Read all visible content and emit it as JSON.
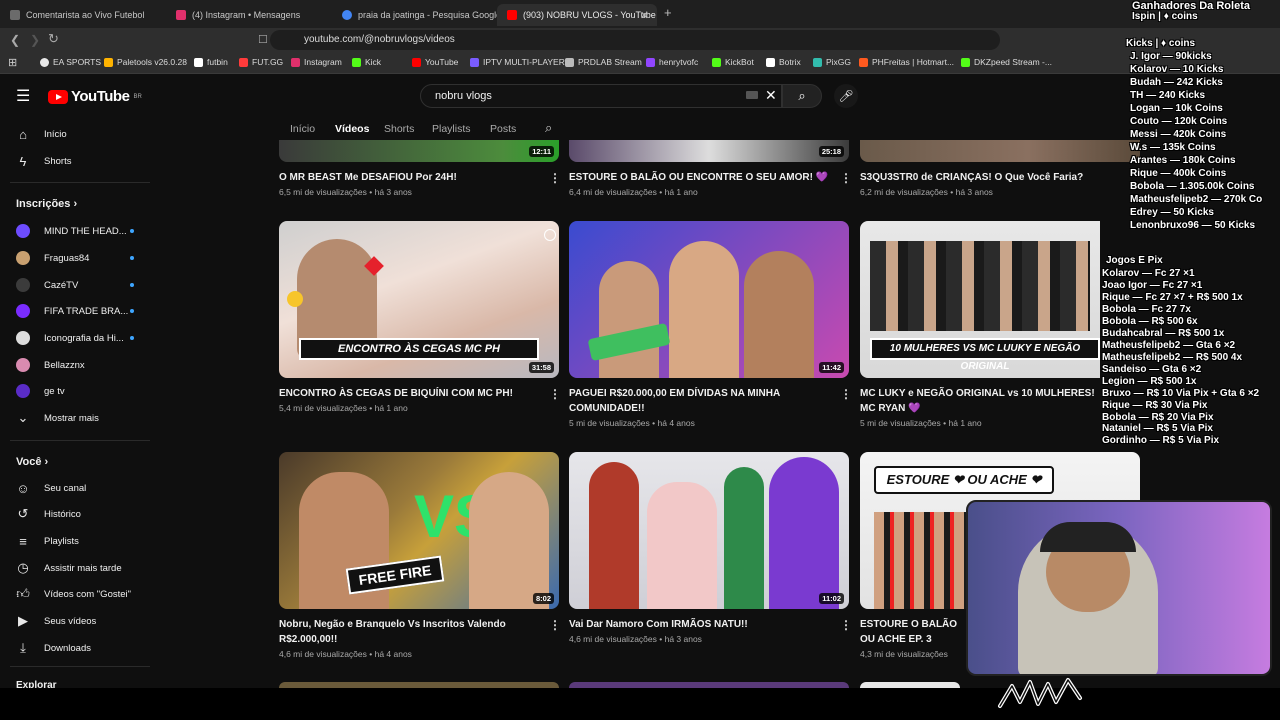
{
  "browser": {
    "tabs": [
      {
        "label": "Comentarista ao Vivo Futebol",
        "color": "#6b6b6b"
      },
      {
        "label": "(4) Instagram • Mensagens",
        "color": "#e1306c"
      },
      {
        "label": "praia da joatinga - Pesquisa Google",
        "color": "#4285f4"
      },
      {
        "label": "(903) NOBRU VLOGS - YouTube",
        "color": "#ff0000"
      }
    ],
    "new_tab": "+",
    "url": "youtube.com/@nobruvlogs/videos",
    "bookmarks": [
      {
        "label": "EA SPORTS",
        "color": "#e8e8e8"
      },
      {
        "label": "Paletools v26.0.28",
        "color": "#ffb300"
      },
      {
        "label": "futbin",
        "color": "#ffffff"
      },
      {
        "label": "FUT.GG",
        "color": "#ff3b3b"
      },
      {
        "label": "Instagram",
        "color": "#e1306c"
      },
      {
        "label": "Kick",
        "color": "#53fc18"
      },
      {
        "label": "YouTube",
        "color": "#ff0000"
      },
      {
        "label": "IPTV MULTI-PLAYER",
        "color": "#7a5cff"
      },
      {
        "label": "PRDLAB Stream",
        "color": "#bbbbbb"
      },
      {
        "label": "henrytvofc",
        "color": "#9146ff"
      },
      {
        "label": "KickBot",
        "color": "#53fc18"
      },
      {
        "label": "Botrix",
        "color": "#ffffff"
      },
      {
        "label": "PixGG",
        "color": "#32bcad"
      },
      {
        "label": "PHFreitas | Hotmart...",
        "color": "#ff5a1f"
      },
      {
        "label": "DKZpeed Stream -...",
        "color": "#53fc18"
      }
    ]
  },
  "youtube": {
    "region": "BR",
    "search_value": "nobru vlogs",
    "channel_tabs": [
      "Início",
      "Vídeos",
      "Shorts",
      "Playlists",
      "Posts"
    ],
    "active_tab": "Vídeos",
    "sidebar": {
      "top": [
        {
          "label": "Início",
          "icon": "home-icon"
        },
        {
          "label": "Shorts",
          "icon": "shorts-icon"
        }
      ],
      "subscriptions_header": "Inscrições",
      "subscriptions": [
        {
          "label": "MIND THE HEAD...",
          "color": "#6d4cff"
        },
        {
          "label": "Fraguas84",
          "color": "#c8a070"
        },
        {
          "label": "CazéTV",
          "color": "#3b3b3b"
        },
        {
          "label": "FIFA TRADE BRA...",
          "color": "#7a2cff"
        },
        {
          "label": "Iconografia da Hi...",
          "color": "#dcdcdc"
        },
        {
          "label": "Bellazznx",
          "color": "#d98bb0"
        },
        {
          "label": "ge tv",
          "color": "#5a2cc7"
        }
      ],
      "show_more": "Mostrar mais",
      "you_header": "Você",
      "you": [
        {
          "label": "Seu canal",
          "icon": "channel-icon"
        },
        {
          "label": "Histórico",
          "icon": "history-icon"
        },
        {
          "label": "Playlists",
          "icon": "playlists-icon"
        },
        {
          "label": "Assistir mais tarde",
          "icon": "watch-later-icon"
        },
        {
          "label": "Vídeos com \"Gostei\"",
          "icon": "like-icon"
        },
        {
          "label": "Seus vídeos",
          "icon": "your-videos-icon"
        },
        {
          "label": "Downloads",
          "icon": "download-icon"
        }
      ],
      "explore_header": "Explorar"
    },
    "videos": [
      {
        "title": "O MR BEAST Me DESAFIOU Por 24H!",
        "views": "6,5 mi de visualizações",
        "age": "há 3 anos",
        "duration": "12:11"
      },
      {
        "title": "ESTOURE O BALÃO OU ENCONTRE O SEU AMOR! 💜",
        "views": "6,4 mi de visualizações",
        "age": "há 1 ano",
        "duration": "25:18"
      },
      {
        "title": "S3QU3STR0 de CRIANÇAS! O Que Você Faria?",
        "views": "6,2 mi de visualizações",
        "age": "há 3 anos",
        "duration": ""
      },
      {
        "title": "ENCONTRO ÀS CEGAS DE BIQUÍNI COM MC PH!",
        "views": "5,4 mi de visualizações",
        "age": "há 1 ano",
        "duration": "31:58",
        "banner": "ENCONTRO ÀS CEGAS MC PH"
      },
      {
        "title": "PAGUEI R$20.000,00 EM DÍVIDAS NA MINHA COMUNIDADE!!",
        "views": "5 mi de visualizações",
        "age": "há 4 anos",
        "duration": "11:42"
      },
      {
        "title": "MC LUKY e NEGÃO ORIGINAL vs 10 MULHERES! MC RYAN 💜",
        "views": "5 mi de visualizações",
        "age": "há 1 ano",
        "duration": "",
        "banner": "10 MULHERES VS MC LUUKY E NEGÃO ORIGINAL"
      },
      {
        "title": "Nobru, Negão e Branquelo Vs Inscritos Valendo R$2.000,00!!",
        "views": "4,6 mi de visualizações",
        "age": "há 4 anos",
        "duration": "8:02",
        "banner": "FREE FIRE"
      },
      {
        "title": "Vai Dar Namoro Com IRMÃOS NATU!!",
        "views": "4,6 mi de visualizações",
        "age": "há 3 anos",
        "duration": "11:02"
      },
      {
        "title": "ESTOURE O BALÃO OU ACHE EP. 3",
        "views": "4,3 mi de visualizações",
        "age": "",
        "duration": "",
        "banner": "ESTOURE ❤ OU ACHE ❤"
      }
    ]
  },
  "overlay": {
    "lines": [
      "Ganhadores Da Roleta",
      "Ispin | ♦ coins",
      "Kicks | ♦ coins",
      "J. Igor — 90kicks",
      "Kolarov — 10 Kicks",
      "Budah — 242 Kicks",
      "TH — 240 Kicks",
      "Logan — 10k Coins",
      "Couto — 120k Coins",
      "Messi — 420k Coins",
      "W.s — 135k Coins",
      "Arantes — 180k Coins",
      "Rique — 400k Coins",
      "Bobola — 1.305.00k Coins",
      "Matheusfelipeb2 — 270k Co",
      "Edrey — 50 Kicks",
      "Lenonbruxo96 — 50 Kicks",
      "Jogos E Pix",
      "Kolarov — Fc 27 ×1",
      "Joao Igor — Fc 27 ×1",
      "Rique — Fc 27 ×7 + R$ 500 1x",
      "Bobola — Fc 27 7x",
      "Bobola — R$ 500 6x",
      "Budahcabral — R$ 500 1x",
      "Matheusfelipeb2 — Gta 6 ×2",
      "Matheusfelipeb2 — R$ 500 4x",
      "Sandeiso — Gta 6 ×2",
      "Legion — R$ 500 1x",
      "Bruxo — R$ 10 Via Pix + Gta 6 ×2",
      "Rique — R$ 30 Via Pix",
      "Bobola — R$ 20 Via Pix",
      "Nataniel — R$ 5 Via Pix",
      "Gordinho — R$ 5 Via Pix"
    ]
  }
}
